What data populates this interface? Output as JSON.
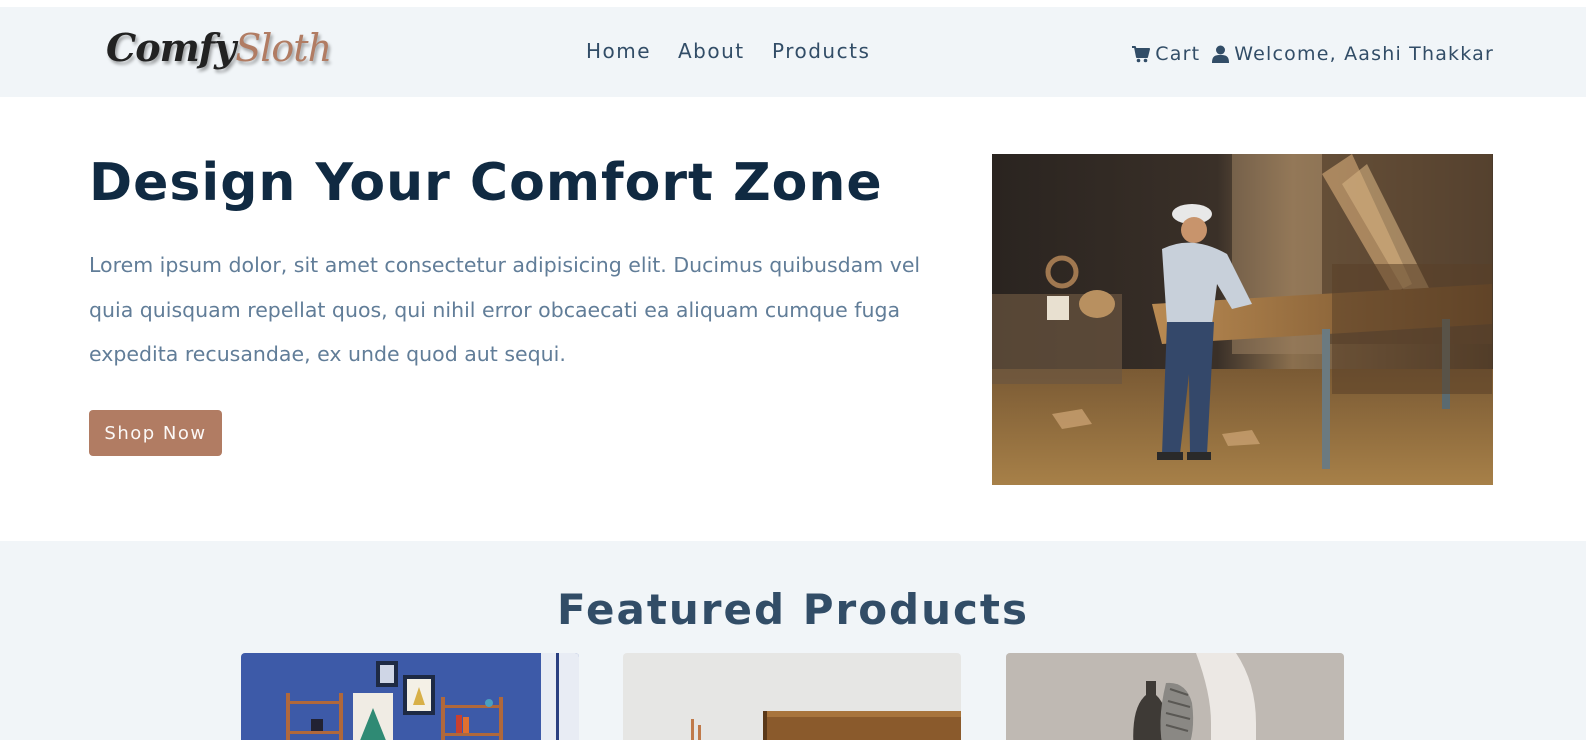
{
  "brand": {
    "logo_part1": "Comfy",
    "logo_part2": "Sloth"
  },
  "nav": {
    "links": [
      "Home",
      "About",
      "Products"
    ],
    "cart_label": "Cart",
    "welcome_text": "Welcome, Aashi Thakkar"
  },
  "hero": {
    "title": "Design Your Comfort Zone",
    "description": "Lorem ipsum dolor, sit amet consectetur adipisicing elit. Ducimus quibusdam vel quia quisquam repellat quos, qui nihil error obcaecati ea aliquam cumque fuga expedita recusandae, ex unde quod aut sequi.",
    "button_label": "Shop Now"
  },
  "featured": {
    "title": "Featured Products"
  },
  "colors": {
    "primary": "#b17c63",
    "heading": "#102a42",
    "nav_bg": "#f1f5f8",
    "body_text": "#617d98",
    "nav_text": "#324d67"
  },
  "icons": {
    "cart": "cart-icon",
    "user": "user-icon"
  }
}
